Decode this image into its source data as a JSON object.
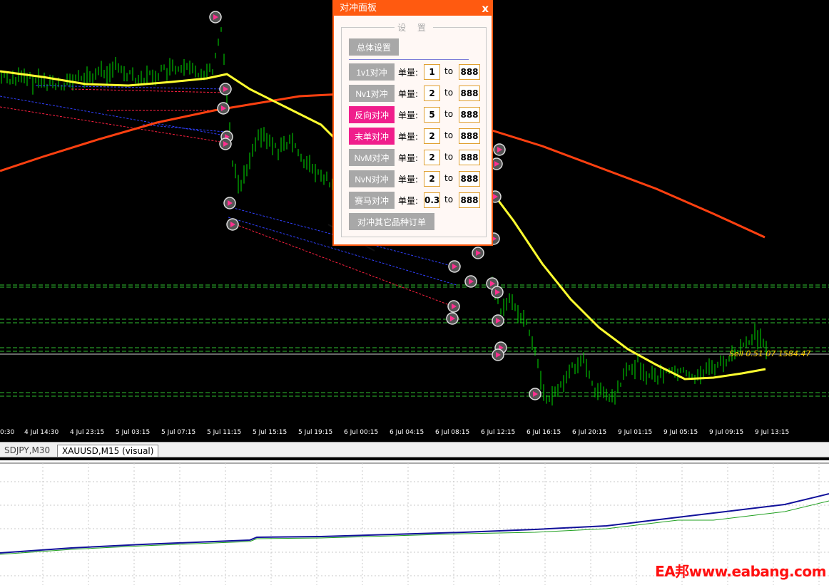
{
  "panel": {
    "title": "对冲面板",
    "close": "x",
    "settings_legend": "设 置",
    "general_settings": "总体设置",
    "lot_label": "单量:",
    "to_label": "to",
    "other_symbols_button": "对冲其它品种订单",
    "rows": [
      {
        "label": "1v1对冲",
        "lot": "1",
        "max": "888",
        "highlighted": false
      },
      {
        "label": "Nv1对冲",
        "lot": "2",
        "max": "888",
        "highlighted": false
      },
      {
        "label": "反向对冲",
        "lot": "5",
        "max": "888",
        "highlighted": true
      },
      {
        "label": "末单对冲",
        "lot": "2",
        "max": "888",
        "highlighted": true
      },
      {
        "label": "NvM对冲",
        "lot": "2",
        "max": "888",
        "highlighted": false
      },
      {
        "label": "NvN对冲",
        "lot": "2",
        "max": "888",
        "highlighted": false
      },
      {
        "label": "赛马对冲",
        "lot": "0.3",
        "max": "888",
        "highlighted": false
      }
    ],
    "colors": {
      "header": "#ff5a10",
      "button_gray": "#a8a8a8",
      "button_pink": "#f01e8c"
    }
  },
  "chart": {
    "price_line_label": "Sell 0.51 07 1584.47",
    "time_labels": [
      "0:30",
      "4 Jul 14:30",
      "4 Jul 23:15",
      "5 Jul 03:15",
      "5 Jul 07:15",
      "5 Jul 11:15",
      "5 Jul 15:15",
      "5 Jul 19:15",
      "6 Jul 00:15",
      "6 Jul 04:15",
      "6 Jul 08:15",
      "6 Jul 12:15",
      "6 Jul 16:15",
      "6 Jul 20:15",
      "9 Jul 01:15",
      "9 Jul 05:15",
      "9 Jul 09:15",
      "9 Jul 13:15"
    ],
    "colors": {
      "candles": "#00e000",
      "ma_fast": "#ffff30",
      "ma_slow": "#ff4010",
      "level_lines": "#30c030"
    }
  },
  "tabs": [
    {
      "label": "SDJPY,M30",
      "active": false
    },
    {
      "label": "XAUUSD,M15 (visual)",
      "active": true
    }
  ],
  "watermark": "EA邦www.eabang.com"
}
